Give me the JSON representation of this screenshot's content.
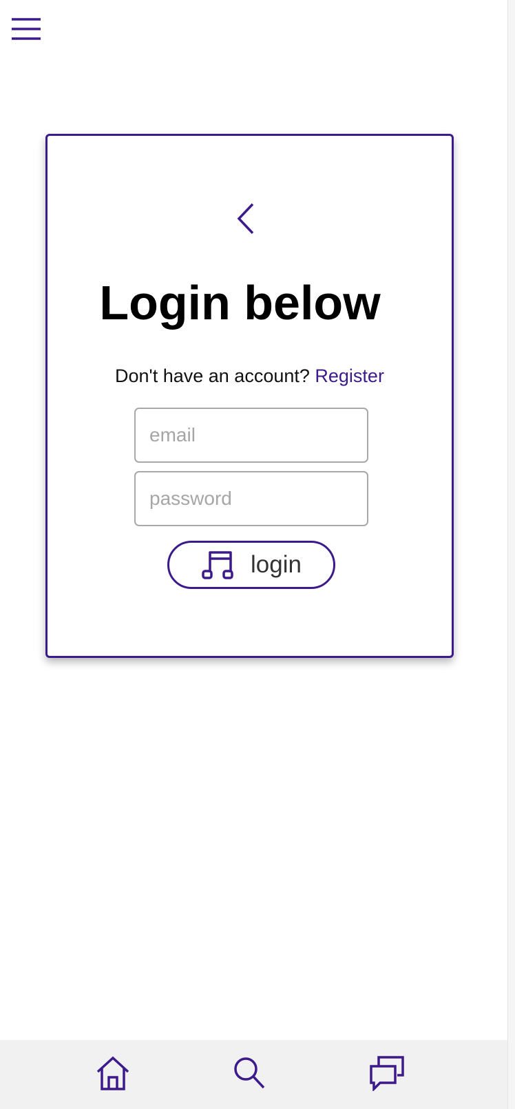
{
  "header": {
    "menu_icon": "hamburger-menu-icon"
  },
  "login_card": {
    "back_icon": "chevron-left-icon",
    "title": "Login below",
    "prompt_text": "Don't have an account?",
    "register_link": "Register",
    "email_placeholder": "email",
    "password_placeholder": "password",
    "login_icon": "music-note-icon",
    "login_label": "login"
  },
  "bottom_nav": {
    "items": [
      {
        "icon": "home-icon"
      },
      {
        "icon": "search-icon"
      },
      {
        "icon": "chat-bubbles-icon"
      }
    ]
  },
  "colors": {
    "accent": "#3c1a8c",
    "input_border": "#a8a8a8",
    "placeholder": "#a6a6a6",
    "bottom_bar": "#f1f1f1"
  }
}
